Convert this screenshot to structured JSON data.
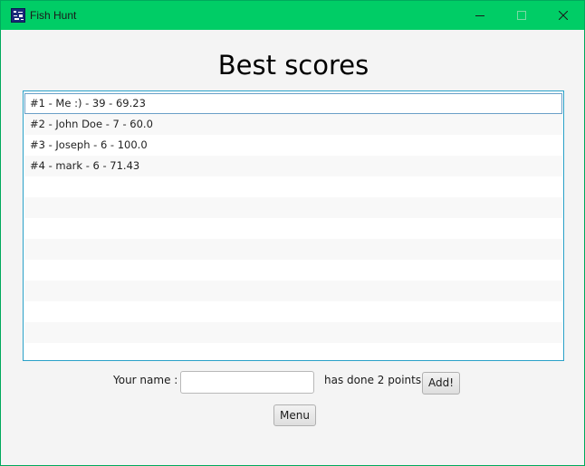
{
  "window": {
    "title": "Fish Hunt",
    "accent_color": "#00cd66"
  },
  "heading": "Best scores",
  "scores": [
    "#1 - Me :) - 39 - 69.23",
    "#2 - John Doe - 7 - 60.0",
    "#3 - Joseph - 6 - 100.0",
    "#4 - mark - 6 - 71.43"
  ],
  "selected_index": 0,
  "form": {
    "name_label": "Your name :",
    "name_value": "",
    "points_label": "has done 2 points!",
    "add_button": "Add!"
  },
  "menu_button": "Menu"
}
